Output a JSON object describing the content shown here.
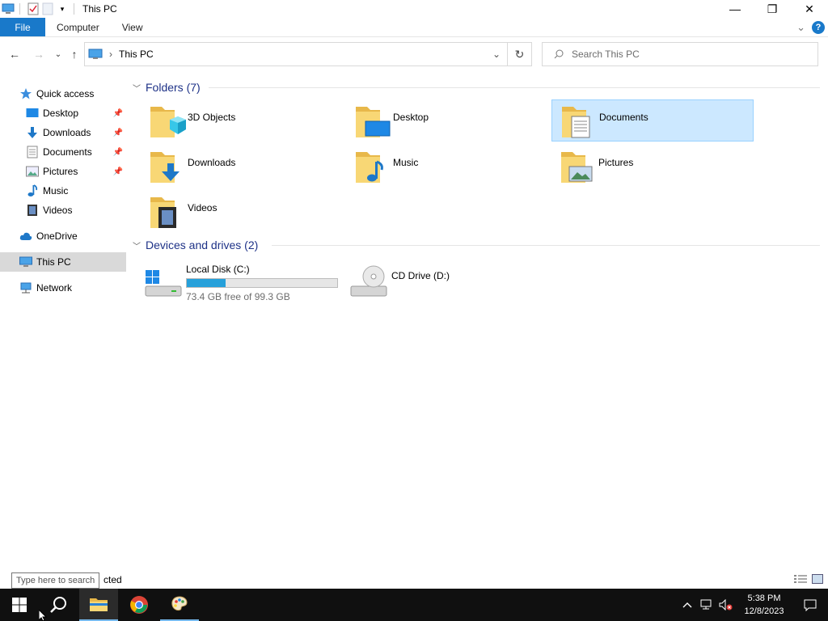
{
  "titlebar": {
    "title": "This PC",
    "minimize": "—",
    "maximize": "❐",
    "close": "✕"
  },
  "ribbon": {
    "file": "File",
    "tabs": [
      "Computer",
      "View"
    ],
    "expand": "⌄",
    "help": "?"
  },
  "nav": {
    "back": "←",
    "forward": "→",
    "recent": "⌄",
    "up": "↑"
  },
  "address": {
    "separator": "›",
    "location": "This PC",
    "dropdown": "⌄",
    "refresh": "↻"
  },
  "search": {
    "placeholder": "Search This PC"
  },
  "navpane": {
    "quick_access": "Quick access",
    "quick_items": [
      {
        "label": "Desktop",
        "icon": "desktop-icon",
        "pinned": true
      },
      {
        "label": "Downloads",
        "icon": "downloads-icon",
        "pinned": true
      },
      {
        "label": "Documents",
        "icon": "documents-icon",
        "pinned": true
      },
      {
        "label": "Pictures",
        "icon": "pictures-icon",
        "pinned": true
      },
      {
        "label": "Music",
        "icon": "music-icon",
        "pinned": false
      },
      {
        "label": "Videos",
        "icon": "videos-icon",
        "pinned": false
      }
    ],
    "onedrive": "OneDrive",
    "this_pc": "This PC",
    "network": "Network"
  },
  "content": {
    "folders_header": "Folders (7)",
    "folders": [
      {
        "label": "3D Objects",
        "icon": "3d-objects-folder-icon",
        "selected": false
      },
      {
        "label": "Desktop",
        "icon": "desktop-folder-icon",
        "selected": false
      },
      {
        "label": "Documents",
        "icon": "documents-folder-icon",
        "selected": true
      },
      {
        "label": "Downloads",
        "icon": "downloads-folder-icon",
        "selected": false
      },
      {
        "label": "Music",
        "icon": "music-folder-icon",
        "selected": false
      },
      {
        "label": "Pictures",
        "icon": "pictures-folder-icon",
        "selected": false
      },
      {
        "label": "Videos",
        "icon": "videos-folder-icon",
        "selected": false
      }
    ],
    "drives_header": "Devices and drives (2)",
    "drives": [
      {
        "label": "Local Disk (C:)",
        "free": "73.4 GB free of 99.3 GB",
        "used_fraction": 0.26
      },
      {
        "label": "CD Drive (D:)"
      }
    ]
  },
  "status": {
    "tooltip": "Type here to search",
    "text": "cted"
  },
  "taskbar": {
    "time": "5:38 PM",
    "date": "12/8/2023"
  },
  "colors": {
    "accent": "#1979ca",
    "selection": "#cce8ff",
    "drive_bar": "#26a0da",
    "header_text": "#1e3287",
    "folder_yellow": "#f8d775"
  }
}
